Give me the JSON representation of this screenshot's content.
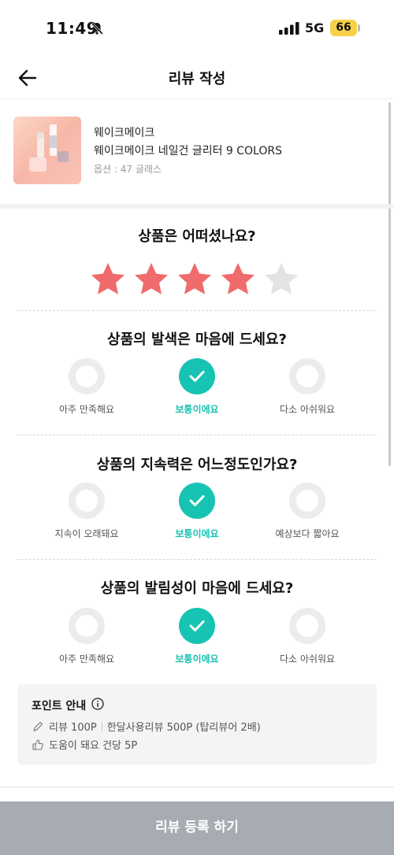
{
  "status_bar": {
    "time": "11:49",
    "network": "5G",
    "battery": "66"
  },
  "header": {
    "title": "리뷰 작성"
  },
  "product": {
    "brand": "웨이크메이크",
    "name": "웨이크메이크 네일건 글리터 9 COLORS",
    "option": "옵션 : 47 글래스"
  },
  "rating": {
    "question": "상품은 어떠셨나요?",
    "score": 4,
    "max": 5,
    "filled_color": "#f06b6b",
    "empty_color": "#e3e3e3"
  },
  "questions": [
    {
      "title": "상품의 발색은 마음에 드세요?",
      "options": [
        "아주 만족해요",
        "보통이에요",
        "다소 아쉬워요"
      ],
      "selected_index": 1
    },
    {
      "title": "상품의 지속력은 어느정도인가요?",
      "options": [
        "지속이 오래돼요",
        "보통이에요",
        "예상보다 짧아요"
      ],
      "selected_index": 1
    },
    {
      "title": "상품의 발림성이 마음에 드세요?",
      "options": [
        "아주 만족해요",
        "보통이에요",
        "다소 아쉬워요"
      ],
      "selected_index": 1
    }
  ],
  "point_info": {
    "title": "포인트 안내",
    "review_points": "리뷰 100P",
    "month_review_points": "한달사용리뷰 500P (탑리뷰어 2배)",
    "helpful_points": "도움이 돼요 건당 5P"
  },
  "submit": {
    "label": "리뷰 등록 하기"
  },
  "colors": {
    "accent": "#17c3b2",
    "submit_bg": "#a7abb2"
  }
}
